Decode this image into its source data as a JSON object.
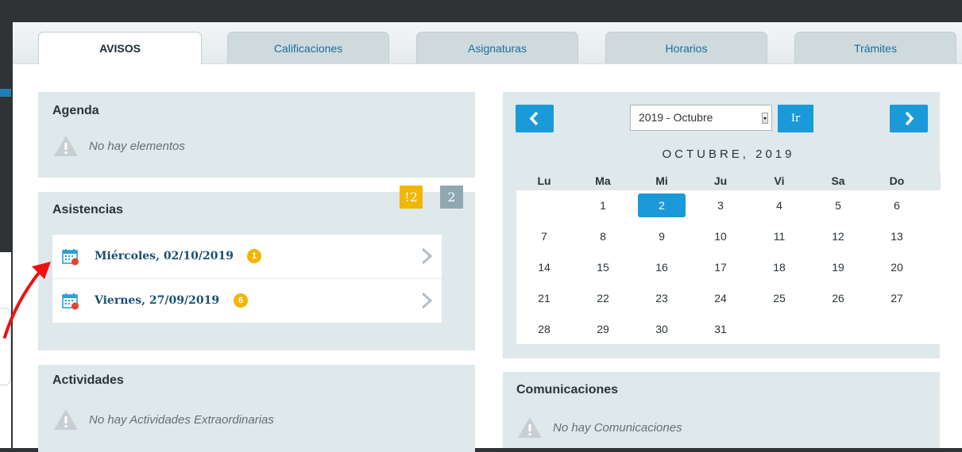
{
  "tabs": [
    {
      "label": "AVISOS",
      "active": true
    },
    {
      "label": "Calificaciones"
    },
    {
      "label": "Asignaturas"
    },
    {
      "label": "Horarios"
    },
    {
      "label": "Trámites"
    }
  ],
  "agenda": {
    "title": "Agenda",
    "empty": "No hay elementos"
  },
  "asistencias": {
    "title": "Asistencias",
    "badge_warn": "!2",
    "badge_count": "2",
    "items": [
      {
        "date": "Miércoles, 02/10/2019",
        "count": "1"
      },
      {
        "date": "Viernes, 27/09/2019",
        "count": "6"
      }
    ]
  },
  "actividades": {
    "title": "Actividades",
    "empty": "No hay Actividades Extraordinarias"
  },
  "calendar": {
    "select_value": "2019 - Octubre",
    "go_label": "Ir",
    "month_title": "OCTUBRE, 2019",
    "weekdays": [
      "Lu",
      "Ma",
      "Mi",
      "Ju",
      "Vi",
      "Sa",
      "Do"
    ],
    "weeks": [
      [
        "",
        "1",
        "2",
        "3",
        "4",
        "5",
        "6"
      ],
      [
        "7",
        "8",
        "9",
        "10",
        "11",
        "12",
        "13"
      ],
      [
        "14",
        "15",
        "16",
        "17",
        "18",
        "19",
        "20"
      ],
      [
        "21",
        "22",
        "23",
        "24",
        "25",
        "26",
        "27"
      ],
      [
        "28",
        "29",
        "30",
        "31",
        "",
        "",
        ""
      ]
    ],
    "today": "2",
    "accent": "#1a9ad8"
  },
  "comunicaciones": {
    "title": "Comunicaciones",
    "empty": "No hay Comunicaciones"
  }
}
